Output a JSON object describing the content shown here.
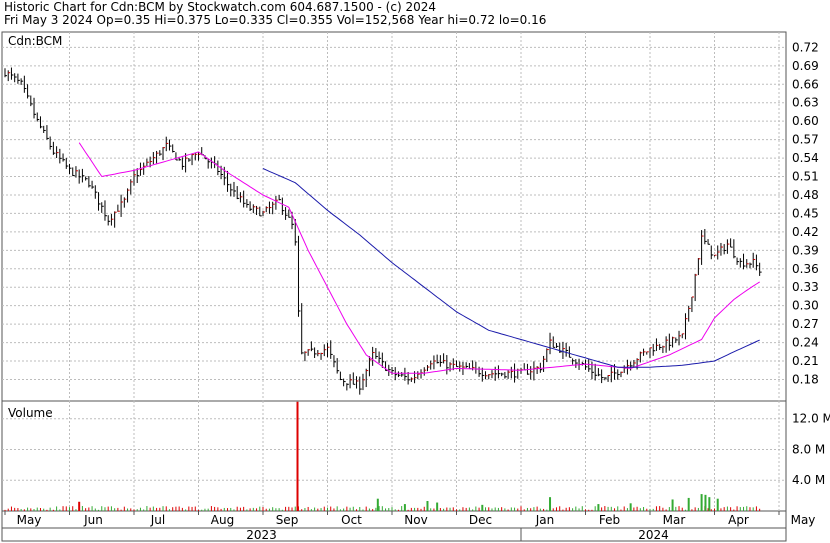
{
  "header": {
    "line1": "Historic Chart for Cdn:BCM by Stockwatch.com 604.687.1500 - (c) 2024",
    "line2": "Fri May  3 2024  Op=0.35  Hi=0.375  Lo=0.335  Cl=0.355  Vol=152,568  Year hi=0.72  lo=0.16"
  },
  "chart_data": [
    {
      "type": "ohlc",
      "title": "Cdn:BCM",
      "ylim": [
        0.145,
        0.745
      ],
      "y_ticks": [
        0.72,
        0.69,
        0.66,
        0.63,
        0.6,
        0.57,
        0.54,
        0.51,
        0.48,
        0.45,
        0.42,
        0.39,
        0.36,
        0.33,
        0.3,
        0.27,
        0.24,
        0.21,
        0.18
      ],
      "y_tick_labels": [
        "0.72",
        "0.69",
        "0.66",
        "0.63",
        "0.60",
        "0.57",
        "0.54",
        "0.51",
        "0.48",
        "0.45",
        "0.42",
        "0.39",
        "0.36",
        "0.33",
        "0.30",
        "0.27",
        "0.24",
        "0.21",
        "0.18"
      ],
      "grid": true,
      "x_months": [
        "May",
        "Jun",
        "Jul",
        "Aug",
        "Sep",
        "Oct",
        "Nov",
        "Dec",
        "Jan",
        "Feb",
        "Mar",
        "Apr",
        "May"
      ],
      "x_years": [
        "2023",
        "2024"
      ],
      "colors": {
        "up": "#cc0000",
        "down": "#000000",
        "ma_short": "#ee00ee",
        "ma_long": "#1a1aaa"
      },
      "close_keypoints": [
        [
          0,
          0.68
        ],
        [
          0.25,
          0.66
        ],
        [
          0.5,
          0.6
        ],
        [
          0.75,
          0.55
        ],
        [
          1,
          0.52
        ],
        [
          1.3,
          0.5
        ],
        [
          1.6,
          0.44
        ],
        [
          1.85,
          0.47
        ],
        [
          2,
          0.51
        ],
        [
          2.3,
          0.54
        ],
        [
          2.5,
          0.56
        ],
        [
          2.75,
          0.53
        ],
        [
          3,
          0.55
        ],
        [
          3.3,
          0.52
        ],
        [
          3.5,
          0.49
        ],
        [
          3.75,
          0.46
        ],
        [
          4,
          0.45
        ],
        [
          4.25,
          0.47
        ],
        [
          4.45,
          0.43
        ],
        [
          4.5,
          0.4
        ],
        [
          4.54,
          0.31
        ],
        [
          4.58,
          0.22
        ],
        [
          5,
          0.23
        ],
        [
          5.2,
          0.18
        ],
        [
          5.5,
          0.17
        ],
        [
          5.7,
          0.22
        ],
        [
          6,
          0.19
        ],
        [
          6.3,
          0.18
        ],
        [
          6.6,
          0.21
        ],
        [
          7,
          0.2
        ],
        [
          7.5,
          0.19
        ],
        [
          8,
          0.19
        ],
        [
          8.3,
          0.2
        ],
        [
          8.45,
          0.24
        ],
        [
          8.6,
          0.23
        ],
        [
          9,
          0.2
        ],
        [
          9.3,
          0.18
        ],
        [
          9.6,
          0.2
        ],
        [
          10,
          0.23
        ],
        [
          10.3,
          0.24
        ],
        [
          10.5,
          0.25
        ],
        [
          10.65,
          0.32
        ],
        [
          10.8,
          0.41
        ],
        [
          11,
          0.38
        ],
        [
          11.2,
          0.4
        ],
        [
          11.4,
          0.37
        ],
        [
          11.6,
          0.37
        ],
        [
          11.72,
          0.355
        ]
      ],
      "ma_short_keypoints": [
        [
          1.15,
          0.565
        ],
        [
          1.5,
          0.51
        ],
        [
          2,
          0.52
        ],
        [
          2.5,
          0.535
        ],
        [
          3,
          0.55
        ],
        [
          3.4,
          0.52
        ],
        [
          4,
          0.48
        ],
        [
          4.4,
          0.46
        ],
        [
          4.7,
          0.39
        ],
        [
          5,
          0.33
        ],
        [
          5.3,
          0.27
        ],
        [
          5.6,
          0.22
        ],
        [
          6,
          0.19
        ],
        [
          6.5,
          0.19
        ],
        [
          7,
          0.198
        ],
        [
          8,
          0.195
        ],
        [
          9,
          0.205
        ],
        [
          9.7,
          0.198
        ],
        [
          10.3,
          0.22
        ],
        [
          10.8,
          0.245
        ],
        [
          11,
          0.28
        ],
        [
          11.3,
          0.31
        ],
        [
          11.5,
          0.325
        ],
        [
          11.72,
          0.34
        ]
      ],
      "ma_long_keypoints": [
        [
          4,
          0.523
        ],
        [
          4.5,
          0.5
        ],
        [
          5,
          0.455
        ],
        [
          5.5,
          0.415
        ],
        [
          6,
          0.37
        ],
        [
          6.5,
          0.33
        ],
        [
          7,
          0.29
        ],
        [
          7.5,
          0.26
        ],
        [
          8,
          0.245
        ],
        [
          8.5,
          0.23
        ],
        [
          9,
          0.215
        ],
        [
          9.5,
          0.2
        ],
        [
          10,
          0.2
        ],
        [
          10.5,
          0.203
        ],
        [
          11,
          0.21
        ],
        [
          11.3,
          0.225
        ],
        [
          11.72,
          0.245
        ]
      ]
    },
    {
      "type": "bar",
      "title": "Volume",
      "ylim": [
        0,
        14.3
      ],
      "y_ticks": [
        4,
        8,
        12
      ],
      "y_tick_labels": [
        "4.0 M",
        "8.0 M",
        "12.0 M"
      ],
      "grid": true,
      "spikes": [
        {
          "x": 4.535,
          "value": 14.2,
          "color": "#dd0000"
        },
        {
          "x": 1.15,
          "value": 1.2,
          "color": "#dd0000"
        },
        {
          "x": 5.78,
          "value": 1.6,
          "color": "#33aa33"
        },
        {
          "x": 6.2,
          "value": 0.9,
          "color": "#33aa33"
        },
        {
          "x": 6.55,
          "value": 1.3,
          "color": "#33aa33"
        },
        {
          "x": 6.7,
          "value": 1.1,
          "color": "#33aa33"
        },
        {
          "x": 7.4,
          "value": 0.8,
          "color": "#33aa33"
        },
        {
          "x": 8.45,
          "value": 1.8,
          "color": "#33aa33"
        },
        {
          "x": 9.2,
          "value": 0.9,
          "color": "#33aa33"
        },
        {
          "x": 9.7,
          "value": 1.0,
          "color": "#33aa33"
        },
        {
          "x": 10.35,
          "value": 1.5,
          "color": "#33aa33"
        },
        {
          "x": 10.6,
          "value": 1.7,
          "color": "#33aa33"
        },
        {
          "x": 10.8,
          "value": 2.2,
          "color": "#33aa33"
        },
        {
          "x": 10.86,
          "value": 2.1,
          "color": "#33aa33"
        },
        {
          "x": 10.92,
          "value": 1.8,
          "color": "#33aa33"
        },
        {
          "x": 11.05,
          "value": 1.6,
          "color": "#33aa33"
        }
      ]
    }
  ]
}
